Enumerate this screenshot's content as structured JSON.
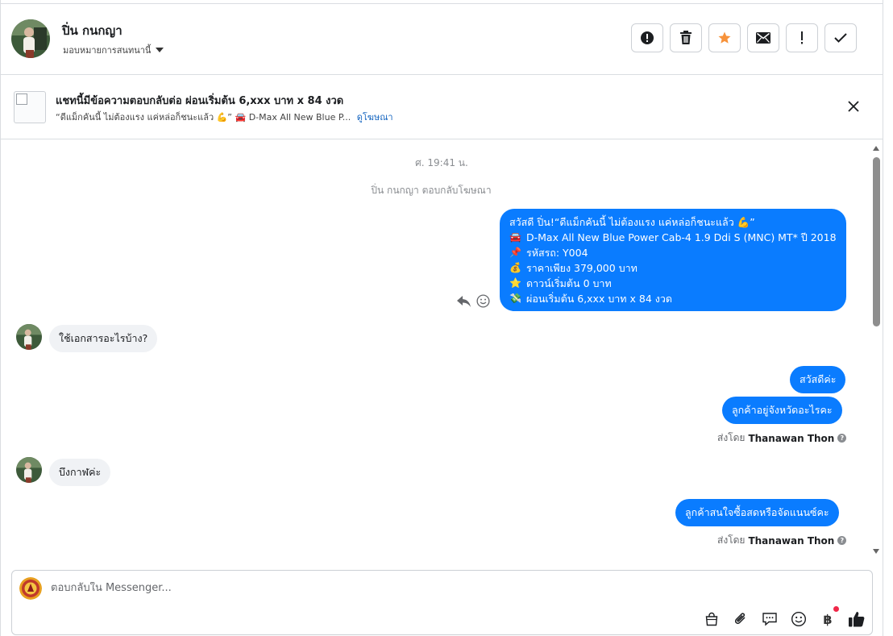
{
  "header": {
    "name": "ปิ่น กนกญา",
    "assign_label": "มอบหมายการสนทนานี้",
    "actions": [
      "report-issue",
      "delete",
      "star",
      "mark-unread",
      "spam",
      "done"
    ]
  },
  "ad": {
    "title": "แชทนี้มีข้อความตอบกลับต่อ ผ่อนเริ่มต้น 6,xxx บาท x 84 งวด",
    "subtitle": "“ดีแม็กคันนี้ ไม่ต้องแรง แค่หล่อก็ชนะแล้ว 💪” 🚘 D-Max All New Blue P...",
    "link": "ดูโฆษณา"
  },
  "chat": {
    "timestamp": "ศ. 19:41 น.",
    "system_note": "ปิ่น กนกญา ตอบกลับโฆษณา",
    "ad_message": {
      "lines": [
        {
          "icon": "",
          "text": "สวัสดี ปิ่น!“ดีแม็กคันนี้ ไม่ต้องแรง แค่หล่อก็ชนะแล้ว 💪”"
        },
        {
          "icon": "🚘",
          "text": "D-Max All New Blue Power Cab-4 1.9 Ddi S (MNC) MT* ปี 2018"
        },
        {
          "icon": "📌",
          "text": "รหัสรถ: Y004"
        },
        {
          "icon": "💰",
          "text": "ราคาเพียง 379,000 บาท"
        },
        {
          "icon": "⭐",
          "text": "ดาวน์เริ่มต้น 0 บาท"
        },
        {
          "icon": "💸",
          "text": "ผ่อนเริ่มต้น 6,xxx บาท x 84 งวด"
        }
      ]
    },
    "incoming_1": "ใช้เอกสารอะไรบ้าง?",
    "outgoing_1": "สวัสดีค่ะ",
    "outgoing_2": "ลูกค้าอยู่จังหวัดอะไรคะ",
    "sent_by_label": "ส่งโดย",
    "sent_by_name": "Thanawan Thon",
    "incoming_2": "บึงกาฬค่ะ",
    "outgoing_3": "ลูกค้าสนใจซื้อสดหรือจัดแนนซ์คะ"
  },
  "composer": {
    "placeholder": "ตอบกลับใน Messenger...",
    "tools": [
      "shopping-bag",
      "attachment",
      "saved-reply",
      "emoji",
      "payment",
      "like"
    ],
    "baht_symbol": "฿"
  },
  "colors": {
    "accent": "#0a7cff",
    "incoming_bubble": "#f0f2f5",
    "star": "#f7923a",
    "notification_dot": "#f02849"
  }
}
